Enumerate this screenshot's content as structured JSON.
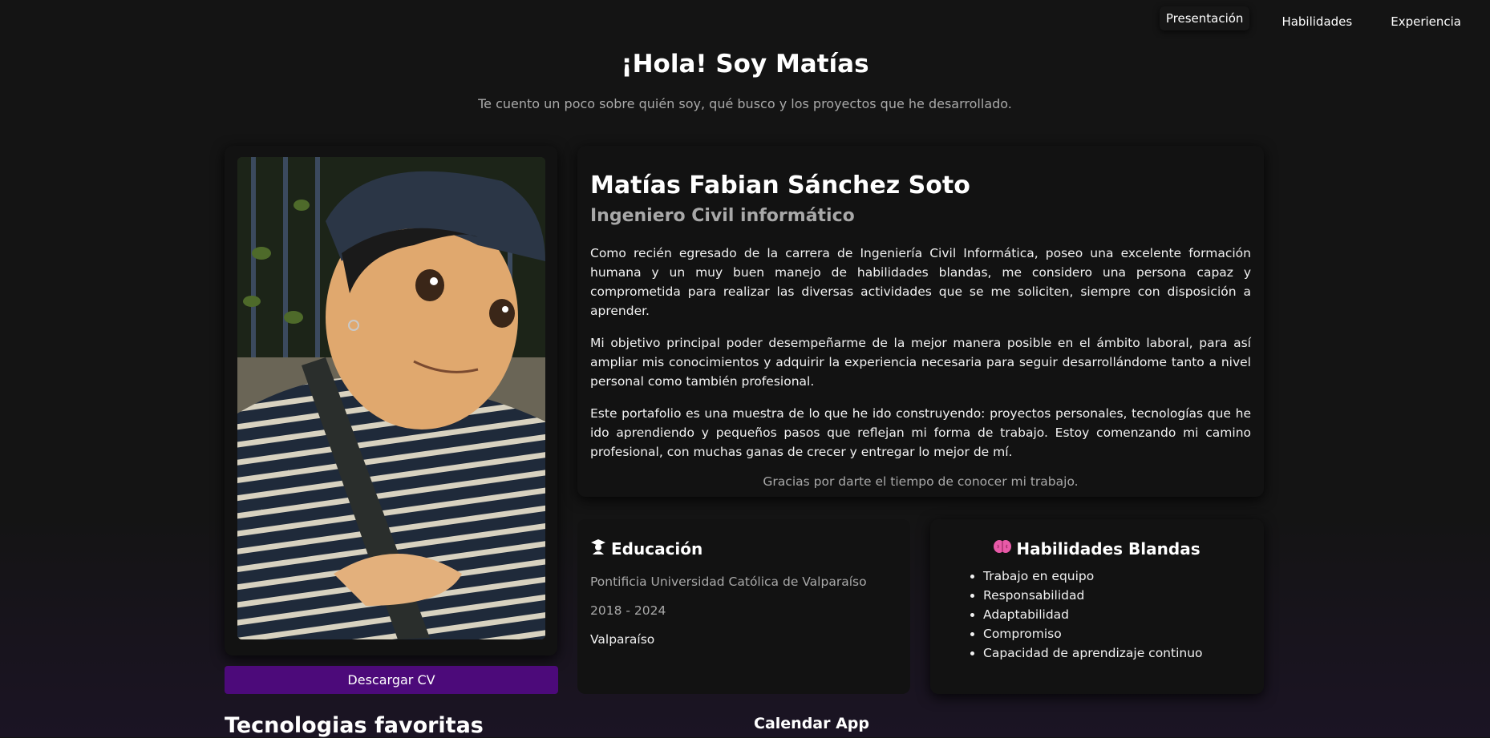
{
  "nav": {
    "items": [
      {
        "label": "Presentación",
        "active": true
      },
      {
        "label": "Habilidades",
        "active": false
      },
      {
        "label": "Experiencia",
        "active": false
      }
    ]
  },
  "hero": {
    "title": "¡Hola! Soy Matías",
    "subtitle": "Te cuento un poco sobre quién soy, qué busco y los proyectos que he desarrollado."
  },
  "profile": {
    "photo_icon": "portrait-illustration",
    "download_cv_label": "Descargar CV"
  },
  "about": {
    "name": "Matías Fabian Sánchez Soto",
    "role": "Ingeniero Civil informático",
    "paragraphs": [
      "Como recién egresado de la carrera de Ingeniería Civil Informática, poseo una excelente formación humana y un muy buen manejo de habilidades blandas, me considero una persona capaz y comprometida para realizar las diversas actividades que se me soliciten, siempre con disposición a aprender.",
      "Mi objetivo principal poder desempeñarme de la mejor manera posible en el ámbito laboral, para así ampliar mis conocimientos y adquirir la experiencia necesaria para seguir desarrollándome tanto a nivel personal como también profesional.",
      "Este portafolio es una muestra de lo que he ido construyendo: proyectos personales, tecnologías que he ido aprendiendo y pequeños pasos que reflejan mi forma de trabajo. Estoy comenzando mi camino profesional, con muchas ganas de crecer y entregar lo mejor de mí."
    ],
    "thanks": "Gracias por darte el tiempo de conocer mi trabajo."
  },
  "education": {
    "icon": "graduate-icon",
    "title": "Educación",
    "university": "Pontificia Universidad Católica de Valparaíso",
    "years": "2018 - 2024",
    "city": "Valparaíso"
  },
  "soft_skills": {
    "icon": "brain-icon",
    "title": "Habilidades Blandas",
    "items": [
      "Trabajo en equipo",
      "Responsabilidad",
      "Adaptabilidad",
      "Compromiso",
      "Capacidad de aprendizaje continuo"
    ]
  },
  "sections": {
    "tech_title": "Tecnologias favoritas",
    "calendar_title": "Calendar App"
  },
  "colors": {
    "background": "#141414",
    "card": "#121212",
    "accent_button": "#4c0a7a",
    "muted_text": "#a9a9a9",
    "brain_icon": "#e85aa8"
  }
}
